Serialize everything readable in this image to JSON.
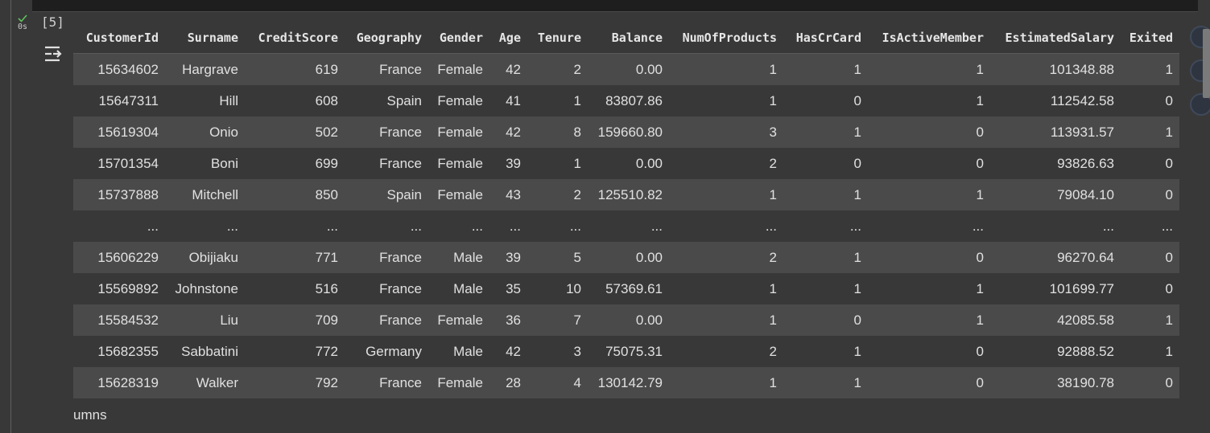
{
  "cell": {
    "execution_count": "[5]",
    "exec_time": "0s",
    "status_color": "#5ec45e"
  },
  "table": {
    "columns": [
      "CustomerId",
      "Surname",
      "CreditScore",
      "Geography",
      "Gender",
      "Age",
      "Tenure",
      "Balance",
      "NumOfProducts",
      "HasCrCard",
      "IsActiveMember",
      "EstimatedSalary",
      "Exited"
    ],
    "rows": [
      [
        "15634602",
        "Hargrave",
        "619",
        "France",
        "Female",
        "42",
        "2",
        "0.00",
        "1",
        "1",
        "1",
        "101348.88",
        "1"
      ],
      [
        "15647311",
        "Hill",
        "608",
        "Spain",
        "Female",
        "41",
        "1",
        "83807.86",
        "1",
        "0",
        "1",
        "112542.58",
        "0"
      ],
      [
        "15619304",
        "Onio",
        "502",
        "France",
        "Female",
        "42",
        "8",
        "159660.80",
        "3",
        "1",
        "0",
        "113931.57",
        "1"
      ],
      [
        "15701354",
        "Boni",
        "699",
        "France",
        "Female",
        "39",
        "1",
        "0.00",
        "2",
        "0",
        "0",
        "93826.63",
        "0"
      ],
      [
        "15737888",
        "Mitchell",
        "850",
        "Spain",
        "Female",
        "43",
        "2",
        "125510.82",
        "1",
        "1",
        "1",
        "79084.10",
        "0"
      ],
      [
        "...",
        "...",
        "...",
        "...",
        "...",
        "...",
        "...",
        "...",
        "...",
        "...",
        "...",
        "...",
        "..."
      ],
      [
        "15606229",
        "Obijiaku",
        "771",
        "France",
        "Male",
        "39",
        "5",
        "0.00",
        "2",
        "1",
        "0",
        "96270.64",
        "0"
      ],
      [
        "15569892",
        "Johnstone",
        "516",
        "France",
        "Male",
        "35",
        "10",
        "57369.61",
        "1",
        "1",
        "1",
        "101699.77",
        "0"
      ],
      [
        "15584532",
        "Liu",
        "709",
        "France",
        "Female",
        "36",
        "7",
        "0.00",
        "1",
        "0",
        "1",
        "42085.58",
        "1"
      ],
      [
        "15682355",
        "Sabbatini",
        "772",
        "Germany",
        "Male",
        "42",
        "3",
        "75075.31",
        "2",
        "1",
        "0",
        "92888.52",
        "1"
      ],
      [
        "15628319",
        "Walker",
        "792",
        "France",
        "Female",
        "28",
        "4",
        "130142.79",
        "1",
        "1",
        "0",
        "38190.78",
        "0"
      ]
    ],
    "ellipsis_row_index": 5
  },
  "footer": {
    "text": "umns"
  }
}
